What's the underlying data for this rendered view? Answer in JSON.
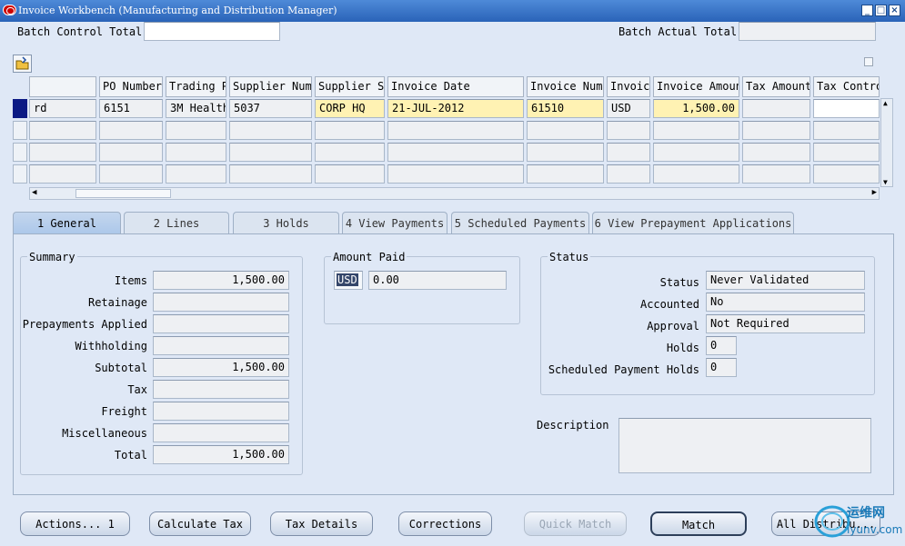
{
  "window": {
    "title": "Invoice Workbench (Manufacturing and Distribution Manager)"
  },
  "batch": {
    "control_total_label": "Batch Control Total",
    "control_total_value": "",
    "actual_total_label": "Batch Actual Total",
    "actual_total_value": ""
  },
  "grid": {
    "columns": [
      "",
      "PO Number",
      "Trading P",
      "Supplier Num",
      "Supplier S:",
      "Invoice Date",
      "Invoice Num",
      "Invoic",
      "Invoice Amoun",
      "Tax Amount",
      "Tax Contro"
    ],
    "row1": {
      "type": "rd",
      "po": "6151",
      "trading": "3M Health",
      "supplier_num": "5037",
      "site": "CORP HQ",
      "date": "21-JUL-2012",
      "invoice_num": "61510",
      "currency": "USD",
      "amount": "1,500.00",
      "tax": "",
      "tax_control": ""
    }
  },
  "tabs": [
    "1 General",
    "2 Lines",
    "3 Holds",
    "4 View Payments",
    "5 Scheduled Payments",
    "6 View Prepayment Applications"
  ],
  "summary": {
    "title": "Summary",
    "rows": [
      {
        "label": "Items",
        "value": "1,500.00"
      },
      {
        "label": "Retainage",
        "value": ""
      },
      {
        "label": "Prepayments Applied",
        "value": ""
      },
      {
        "label": "Withholding",
        "value": ""
      },
      {
        "label": "Subtotal",
        "value": "1,500.00"
      },
      {
        "label": "Tax",
        "value": ""
      },
      {
        "label": "Freight",
        "value": ""
      },
      {
        "label": "Miscellaneous",
        "value": ""
      },
      {
        "label": "Total",
        "value": "1,500.00"
      }
    ]
  },
  "amount_paid": {
    "title": "Amount Paid",
    "currency": "USD",
    "value": "0.00"
  },
  "status": {
    "title": "Status",
    "rows": [
      {
        "label": "Status",
        "value": "Never Validated"
      },
      {
        "label": "Accounted",
        "value": "No"
      },
      {
        "label": "Approval",
        "value": "Not Required"
      },
      {
        "label": "Holds",
        "value": "0"
      },
      {
        "label": "Scheduled Payment Holds",
        "value": "0"
      }
    ]
  },
  "description": {
    "label": "Description",
    "value": ""
  },
  "buttons": [
    "Actions... 1",
    "Calculate Tax",
    "Tax Details",
    "Corrections",
    "Quick Match",
    "Match",
    "All Distribu..."
  ],
  "watermark": {
    "text1": "运维网",
    "text2": "iyunv.com"
  },
  "colors": {
    "title_bar": "#2a63b8",
    "highlight_field": "#fff2b3",
    "row_indicator": "#0b1a84"
  }
}
